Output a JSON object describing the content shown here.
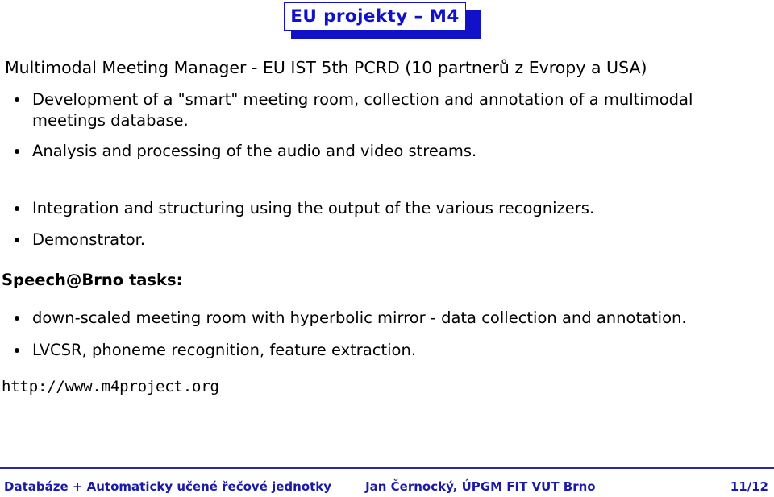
{
  "slide": {
    "title": "EU projekty – M4",
    "title_colors": {
      "text": "#1111c8",
      "box_border": "#1111c8",
      "box_fill": "#ffffff",
      "shadow": "#1111c8"
    },
    "lead": "Multimodal Meeting Manager - EU IST 5th PCRD (10 partnerů z Evropy a USA)",
    "bullets_top": [
      "Development of a \"smart\" meeting room, collection and annotation of a multimodal meetings database.",
      "Analysis and processing of the audio and video streams.",
      "Integration and structuring using the output of the various recognizers.",
      "Demonstrator."
    ],
    "section_heading": "Speech@Brno tasks:",
    "bullets_bottom": [
      "down-scaled meeting room with hyperbolic mirror - data collection and annotation.",
      "LVCSR, phoneme recognition, feature extraction."
    ],
    "url": "http://www.m4project.org"
  },
  "footer": {
    "left": "Databáze + Automaticky učené řečové jednotky",
    "center": "Jan Černocký, ÚPGM FIT VUT Brno",
    "page": "11/12",
    "color": "#1a1aa8",
    "rule_color": "#2a2aa8"
  }
}
